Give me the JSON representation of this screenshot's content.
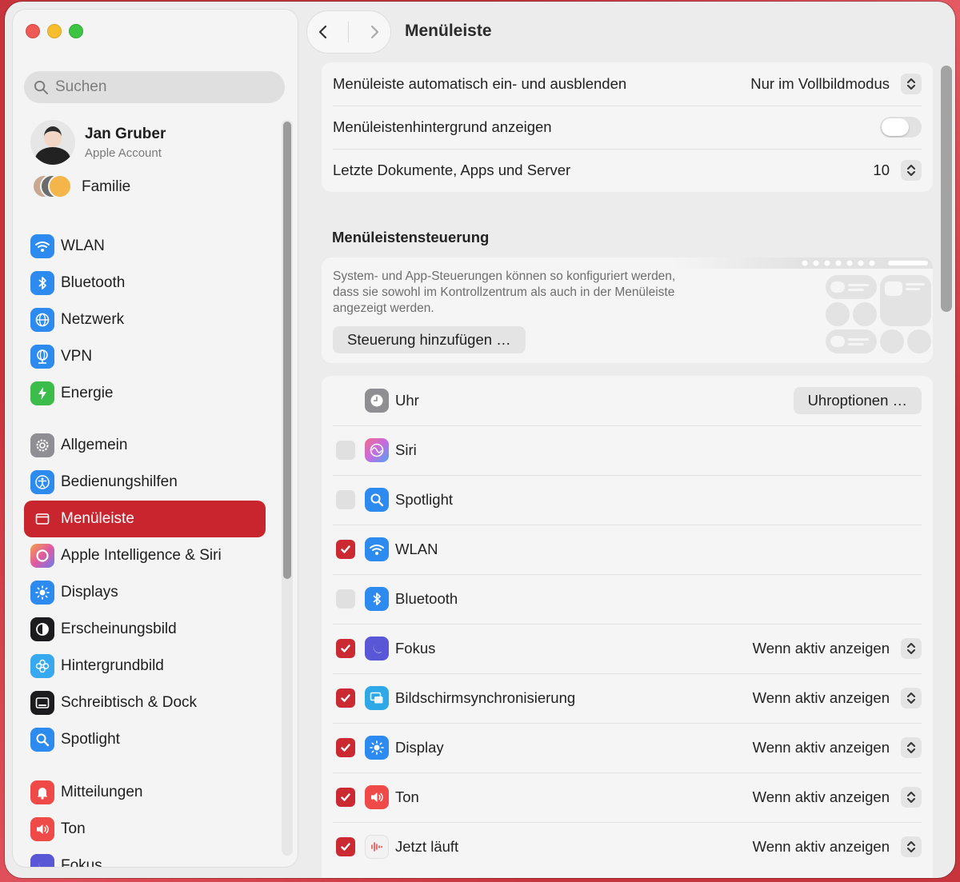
{
  "window": {
    "title": "Menüleiste"
  },
  "sidebar": {
    "search_placeholder": "Suchen",
    "account": {
      "name": "Jan Gruber",
      "subtitle": "Apple Account"
    },
    "family_label": "Familie",
    "items": [
      {
        "label": "WLAN",
        "icon": "wifi-icon",
        "color": "#2d8bf0"
      },
      {
        "label": "Bluetooth",
        "icon": "bluetooth-icon",
        "color": "#2d8bf0"
      },
      {
        "label": "Netzwerk",
        "icon": "globe-icon",
        "color": "#2d8bf0"
      },
      {
        "label": "VPN",
        "icon": "vpn-globe-icon",
        "color": "#2d8bf0"
      },
      {
        "label": "Energie",
        "icon": "battery-bolt-icon",
        "color": "#3cbc4a"
      },
      {
        "label": "Allgemein",
        "icon": "gear-icon",
        "color": "#8e8e93"
      },
      {
        "label": "Bedienungshilfen",
        "icon": "accessibility-icon",
        "color": "#2d8bf0"
      },
      {
        "label": "Menüleiste",
        "icon": "menubar-icon",
        "color": "#c8252f",
        "selected": true
      },
      {
        "label": "Apple Intelligence & Siri",
        "icon": "apple-intelligence-icon",
        "color": "#e8753a"
      },
      {
        "label": "Displays",
        "icon": "sun-icon",
        "color": "#2d8bf0"
      },
      {
        "label": "Erscheinungsbild",
        "icon": "appearance-icon",
        "color": "#1c1c1e"
      },
      {
        "label": "Hintergrundbild",
        "icon": "flower-icon",
        "color": "#36a9f0"
      },
      {
        "label": "Schreibtisch & Dock",
        "icon": "dock-icon",
        "color": "#1c1c1e"
      },
      {
        "label": "Spotlight",
        "icon": "magnifier-icon",
        "color": "#2d8bf0"
      },
      {
        "label": "Mitteilungen",
        "icon": "bell-icon",
        "color": "#ef4a48"
      },
      {
        "label": "Ton",
        "icon": "speaker-icon",
        "color": "#ef4a48"
      },
      {
        "label": "Fokus",
        "icon": "moon-icon",
        "color": "#5a57d6"
      }
    ]
  },
  "settings": {
    "autohide": {
      "label": "Menüleiste automatisch ein- und ausblenden",
      "value": "Nur im Vollbildmodus"
    },
    "background": {
      "label": "Menüleistenhintergrund anzeigen",
      "enabled": false
    },
    "recent": {
      "label": "Letzte Dokumente, Apps und Server",
      "value": "10"
    }
  },
  "menubar_controls": {
    "title": "Menüleistensteuerung",
    "description": "System- und App-Steuerungen können so konfiguriert werden, dass sie sowohl im Kontrollzentrum als auch in der Menüleiste angezeigt werden.",
    "add_button": "Steuerung hinzufügen …",
    "clock_options_button": "Uhroptionen …",
    "items": [
      {
        "label": "Uhr",
        "icon": "clock-icon",
        "color": "#8e8e93",
        "checkbox": "none"
      },
      {
        "label": "Siri",
        "icon": "siri-icon",
        "color": "#e86aa5",
        "checked": false
      },
      {
        "label": "Spotlight",
        "icon": "magnifier-icon",
        "color": "#2d8bf0",
        "checked": false
      },
      {
        "label": "WLAN",
        "icon": "wifi-icon",
        "color": "#2d8bf0",
        "checked": true
      },
      {
        "label": "Bluetooth",
        "icon": "bluetooth-icon",
        "color": "#2d8bf0",
        "checked": false
      },
      {
        "label": "Fokus",
        "icon": "moon-icon",
        "color": "#5a57d6",
        "checked": true,
        "option": "Wenn aktiv anzeigen"
      },
      {
        "label": "Bildschirmsynchronisierung",
        "icon": "screen-mirroring-icon",
        "color": "#2fa8e8",
        "checked": true,
        "option": "Wenn aktiv anzeigen"
      },
      {
        "label": "Display",
        "icon": "sun-icon",
        "color": "#2d8bf0",
        "checked": true,
        "option": "Wenn aktiv anzeigen"
      },
      {
        "label": "Ton",
        "icon": "speaker-icon",
        "color": "#ef4a48",
        "checked": true,
        "option": "Wenn aktiv anzeigen"
      },
      {
        "label": "Jetzt läuft",
        "icon": "now-playing-icon",
        "color": "#f2f2f2",
        "checked": true,
        "option": "Wenn aktiv anzeigen"
      }
    ]
  }
}
